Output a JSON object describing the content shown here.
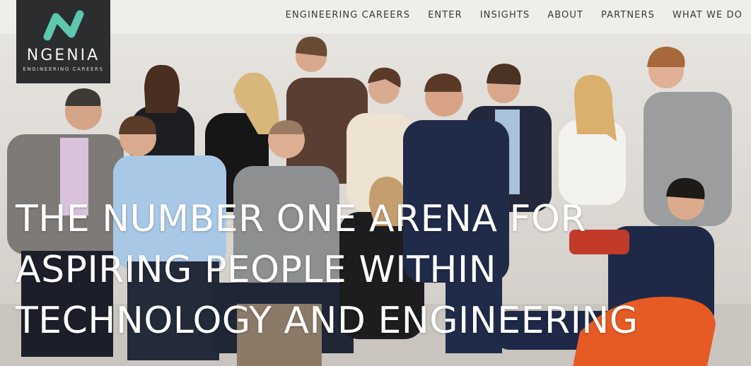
{
  "brand": {
    "name": "NGENIA",
    "tagline": "ENGINEERING CAREERS",
    "mark_color": "#5cc8b0",
    "panel_color": "#2b2d2f"
  },
  "nav": {
    "items": [
      {
        "label": "ENGINEERING CAREERS"
      },
      {
        "label": "ENTER"
      },
      {
        "label": "INSIGHTS"
      },
      {
        "label": "ABOUT"
      },
      {
        "label": "PARTNERS"
      },
      {
        "label": "WHAT WE DO"
      }
    ]
  },
  "hero": {
    "headline_lines": [
      "THE NUMBER ONE ARENA FOR",
      "ASPIRING PEOPLE WITHIN",
      "TECHNOLOGY AND ENGINEERING"
    ]
  }
}
